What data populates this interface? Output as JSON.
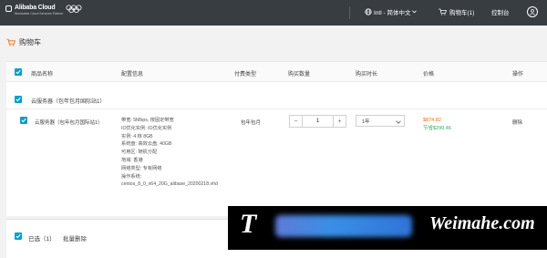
{
  "topbar": {
    "logo_title": "Alibaba Cloud",
    "logo_subtitle": "Worldwide Cloud Services Partner",
    "language": "Intl - 简体中文",
    "cart": "购物车(1)",
    "console": "控制台",
    "accent": "#373d41"
  },
  "page": {
    "title": "购物车"
  },
  "table": {
    "headers": [
      "商品名称",
      "配置信息",
      "付费类型",
      "购买数量",
      "购买时长",
      "价格",
      "操作"
    ]
  },
  "group": {
    "label": "云服务器（包年包月国际站1）"
  },
  "item": {
    "name": "云服务器（包年包月国际站1）",
    "config": [
      "带宽: 5Mbps, 按固定带宽",
      "IO优化实例: IO优化实例",
      "实例: 4 核 8GB",
      "系统盘: 高效云盘, 40GB",
      "可用区: 随机分配",
      "地域: 香港",
      "网络类型: 专有网络",
      "操作系统:",
      "centos_8_0_x64_20G_alibase_20200218.vhd"
    ],
    "billing": "包年包月",
    "quantity": "1",
    "duration": "1年",
    "price": "$874.82",
    "saving": "节省$299.46",
    "delete": "删除"
  },
  "footer": {
    "selected": "已选（1）",
    "bulk_delete": "批量删除"
  },
  "watermark": {
    "left": "T",
    "right": "Weimahe.com"
  }
}
